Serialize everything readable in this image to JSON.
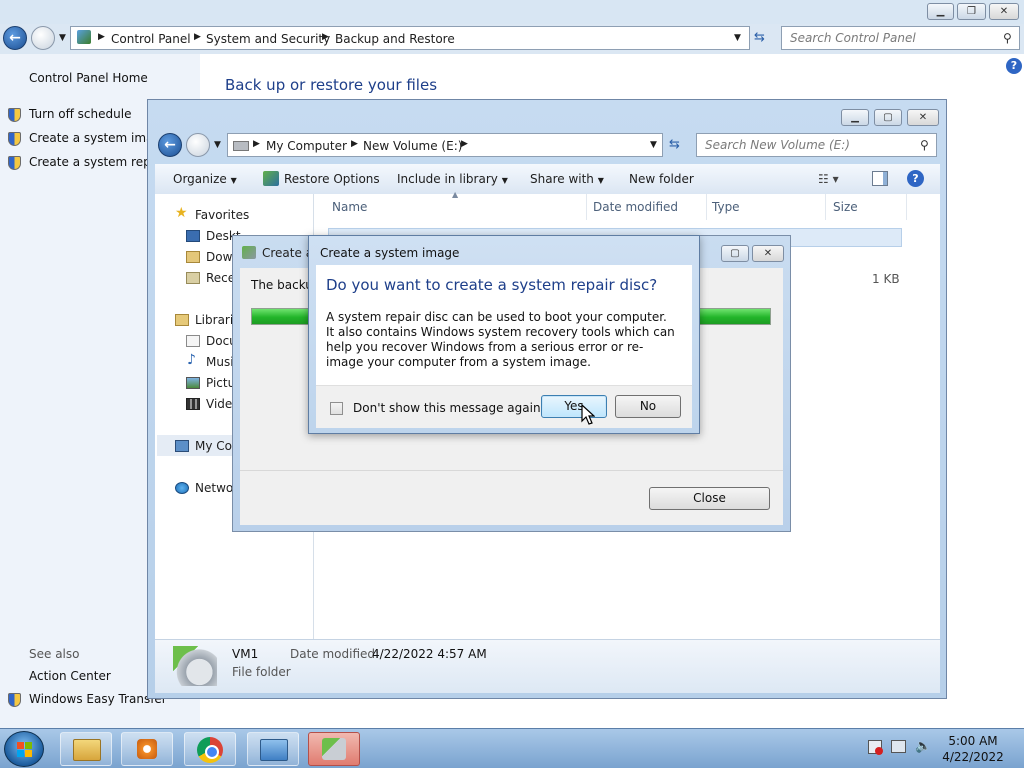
{
  "control_panel": {
    "breadcrumb": [
      "Control Panel",
      "System and Security",
      "Backup and Restore"
    ],
    "search_placeholder": "Search Control Panel",
    "heading": "Back up or restore your files",
    "sidebar": {
      "home": "Control Panel Home",
      "items": [
        "Turn off schedule",
        "Create a system image",
        "Create a system repair"
      ],
      "see_also": "See also",
      "see_also_items": [
        "Action Center",
        "Windows Easy Transfer"
      ]
    }
  },
  "explorer": {
    "breadcrumb": [
      "My Computer",
      "New Volume (E:)"
    ],
    "search_placeholder": "Search New Volume (E:)",
    "toolbar": [
      "Organize",
      "Restore Options",
      "Include in library",
      "Share with",
      "New folder"
    ],
    "nav": {
      "favorites": "Favorites",
      "favorites_items": [
        "Deskt",
        "Down",
        "Rece"
      ],
      "libraries": "Librari",
      "library_items": [
        "Docu",
        "Musi",
        "Pictu",
        "Video"
      ],
      "computer": "My Co",
      "network": "Netwo"
    },
    "columns": [
      "Name",
      "Date modified",
      "Type",
      "Size"
    ],
    "row_size": "1 KB",
    "details": {
      "name": "VM1",
      "date_label": "Date modified:",
      "date_value": "4/22/2022 4:57 AM",
      "type": "File folder"
    }
  },
  "background_dialog": {
    "title": "Create a",
    "body_text": "The backup",
    "progress": 1.0,
    "close_button": "Close"
  },
  "modal": {
    "title": "Create a system image",
    "heading": "Do you want to create a system repair disc?",
    "body": "A system repair disc can be used to boot your computer. It also contains Windows system recovery tools which can help you recover Windows from a serious error or re-image your computer from a system image.",
    "checkbox_label": "Don't show this message again",
    "yes_button": "Yes",
    "no_button": "No"
  },
  "taskbar": {
    "time": "5:00 AM",
    "date": "4/22/2022"
  }
}
